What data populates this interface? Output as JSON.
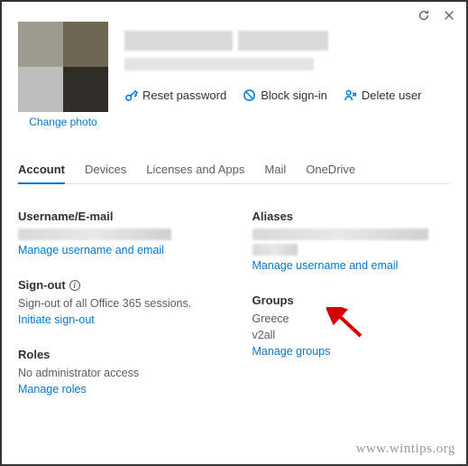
{
  "header": {
    "change_photo": "Change photo"
  },
  "actions": {
    "reset_password": "Reset password",
    "block_signin": "Block sign-in",
    "delete_user": "Delete user"
  },
  "tabs": {
    "account": "Account",
    "devices": "Devices",
    "licenses": "Licenses and Apps",
    "mail": "Mail",
    "onedrive": "OneDrive"
  },
  "sections": {
    "username": {
      "title": "Username/E-mail",
      "manage": "Manage username and email"
    },
    "signout": {
      "title": "Sign-out",
      "body": "Sign-out of all Office 365 sessions.",
      "link": "Initiate sign-out"
    },
    "roles": {
      "title": "Roles",
      "body": "No administrator access",
      "link": "Manage roles"
    },
    "aliases": {
      "title": "Aliases",
      "manage": "Manage username and email"
    },
    "groups": {
      "title": "Groups",
      "line1": "Greece",
      "line2": "v2all",
      "link": "Manage groups"
    }
  },
  "watermark": "www.wintips.org"
}
